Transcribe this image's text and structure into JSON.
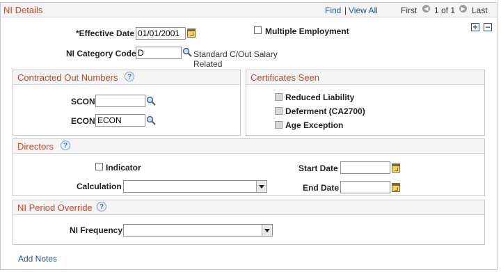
{
  "header": {
    "title": "NI Details",
    "find": "Find",
    "separator": "|",
    "view_all": "View All",
    "first": "First",
    "page_info": "1 of 1",
    "last": "Last"
  },
  "controls": {
    "add": "+",
    "remove": "−"
  },
  "fields": {
    "effective_date_label": "*Effective Date",
    "effective_date_value": "01/01/2001",
    "multiple_employment_label": "Multiple Employment",
    "ni_category_label": "NI Category Code",
    "ni_category_value": "D",
    "ni_category_desc_1": "Standard C/Out Salary",
    "ni_category_desc_2": "Related"
  },
  "contracted_out": {
    "title": "Contracted Out Numbers",
    "scon_label": "SCON",
    "scon_value": "",
    "econ_label": "ECON",
    "econ_value": "ECON"
  },
  "certificates": {
    "title": "Certificates Seen",
    "items": [
      "Reduced Liability",
      "Deferment (CA2700)",
      "Age Exception"
    ]
  },
  "directors": {
    "title": "Directors",
    "indicator_label": "Indicator",
    "calculation_label": "Calculation",
    "calculation_value": "",
    "start_date_label": "Start Date",
    "start_date_value": "",
    "end_date_label": "End Date",
    "end_date_value": ""
  },
  "ni_period": {
    "title": "NI Period Override",
    "frequency_label": "NI Frequency",
    "frequency_value": ""
  },
  "footer": {
    "add_notes": "Add Notes"
  },
  "colors": {
    "section_title": "#c0482a",
    "link": "#1a54a6",
    "border": "#c7c7c7"
  }
}
